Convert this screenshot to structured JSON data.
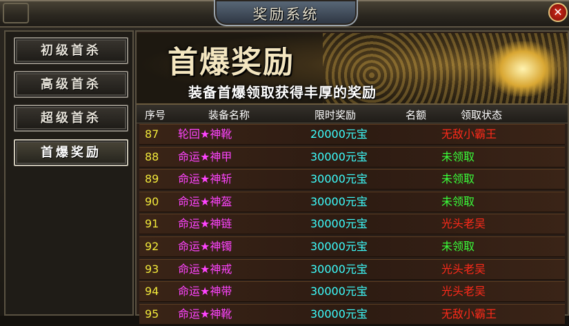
{
  "window": {
    "title": "奖励系统",
    "close_label": "✕"
  },
  "sidebar": {
    "items": [
      {
        "label": "初级首杀",
        "active": false
      },
      {
        "label": "高级首杀",
        "active": false
      },
      {
        "label": "超级首杀",
        "active": false
      },
      {
        "label": "首爆奖励",
        "active": true
      }
    ]
  },
  "banner": {
    "title": "首爆奖励",
    "subtitle": "装备首爆领取获得丰厚的奖励"
  },
  "table": {
    "headers": [
      "序号",
      "装备名称",
      "限时奖励",
      "名额",
      "领取状态"
    ],
    "rows": [
      {
        "no": "87",
        "name": "轮回★神靴",
        "reward": "20000元宝",
        "status": "无敌小霸王",
        "status_color": "#ff2a1a"
      },
      {
        "no": "88",
        "name": "命运★神甲",
        "reward": "30000元宝",
        "status": "未领取",
        "status_color": "#3aff3a"
      },
      {
        "no": "89",
        "name": "命运★神斩",
        "reward": "30000元宝",
        "status": "未领取",
        "status_color": "#3aff3a"
      },
      {
        "no": "90",
        "name": "命运★神盔",
        "reward": "30000元宝",
        "status": "未领取",
        "status_color": "#3aff3a"
      },
      {
        "no": "91",
        "name": "命运★神链",
        "reward": "30000元宝",
        "status": "光头老吴",
        "status_color": "#ff2a1a"
      },
      {
        "no": "92",
        "name": "命运★神镯",
        "reward": "30000元宝",
        "status": "未领取",
        "status_color": "#3aff3a"
      },
      {
        "no": "93",
        "name": "命运★神戒",
        "reward": "30000元宝",
        "status": "光头老吴",
        "status_color": "#ff2a1a"
      },
      {
        "no": "94",
        "name": "命运★神带",
        "reward": "30000元宝",
        "status": "光头老吴",
        "status_color": "#ff2a1a"
      },
      {
        "no": "95",
        "name": "命运★神靴",
        "reward": "30000元宝",
        "status": "无敌小霸王",
        "status_color": "#ff2a1a"
      }
    ]
  },
  "colors": {
    "number": "#f2e93b",
    "item_name": "#ff44ff",
    "reward": "#3dffff",
    "unclaimed": "#3aff3a",
    "claimed": "#ff2a1a"
  }
}
